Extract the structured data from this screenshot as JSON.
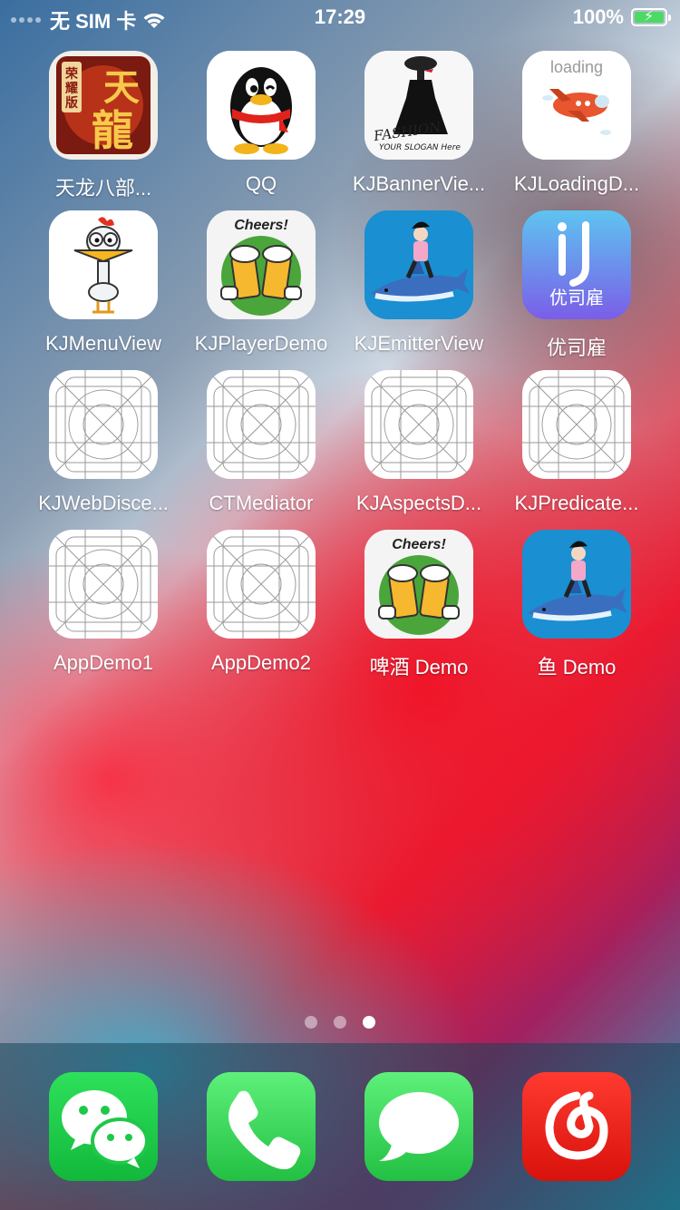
{
  "status_bar": {
    "carrier": "无 SIM 卡",
    "time": "17:29",
    "battery": "100%",
    "battery_charging": true
  },
  "home_apps": [
    {
      "label": "天龙八部...",
      "icon": "tianlong-game-icon"
    },
    {
      "label": "QQ",
      "icon": "qq-penguin-icon"
    },
    {
      "label": "KJBannerVie...",
      "icon": "fashion-dress-icon",
      "icon_text": "FASHION",
      "icon_subtext": "YOUR SLOGAN Here"
    },
    {
      "label": "KJLoadingD...",
      "icon": "loading-airplane-icon",
      "icon_text": "loading"
    },
    {
      "label": "KJMenuView",
      "icon": "chicken-cartoon-icon"
    },
    {
      "label": "KJPlayerDemo",
      "icon": "beer-cheers-icon",
      "icon_text": "Cheers!"
    },
    {
      "label": "KJEmitterView",
      "icon": "shark-rider-icon"
    },
    {
      "label": "优司雇",
      "icon": "youguqi-app-icon",
      "icon_text": "优司雇"
    },
    {
      "label": "KJWebDisce...",
      "icon": "placeholder-grid-icon"
    },
    {
      "label": "CTMediator",
      "icon": "placeholder-grid-icon"
    },
    {
      "label": "KJAspectsD...",
      "icon": "placeholder-grid-icon"
    },
    {
      "label": "KJPredicate...",
      "icon": "placeholder-grid-icon"
    },
    {
      "label": "AppDemo1",
      "icon": "placeholder-grid-icon"
    },
    {
      "label": "AppDemo2",
      "icon": "placeholder-grid-icon"
    },
    {
      "label": "啤酒 Demo",
      "icon": "beer-cheers-icon",
      "icon_text": "Cheers!"
    },
    {
      "label": "鱼 Demo",
      "icon": "shark-rider-icon"
    }
  ],
  "page_indicator": {
    "count": 3,
    "current": 3
  },
  "dock_apps": [
    {
      "icon": "wechat-icon",
      "color": "#1ec84a"
    },
    {
      "icon": "phone-icon",
      "color": "#34c759"
    },
    {
      "icon": "messages-icon",
      "color": "#34c759"
    },
    {
      "icon": "netease-music-icon",
      "color": "#e21b1b"
    }
  ],
  "colors": {
    "tianlong_bg": "#7a1a10",
    "qq_red_scarf": "#e0231b",
    "shark_bg": "#1a8fd1",
    "youguqi_bg": "#6a78e8",
    "beer_bg": "#4aa53a"
  }
}
